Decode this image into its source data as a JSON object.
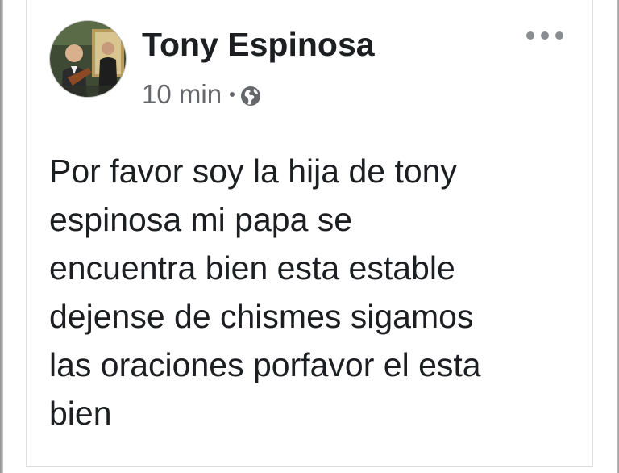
{
  "post": {
    "author": "Tony Espinosa",
    "time": "10 min",
    "audience_icon": "globe-icon",
    "menu_icon": "more-options-icon",
    "text": "Por favor soy la hija de tony\nespinosa mi papa se\nencuentra bien esta estable\ndejense de chismes sigamos\nlas oraciones porfavor el esta\nbien"
  },
  "colors": {
    "text_primary": "#1c1e21",
    "text_secondary": "#65676b",
    "card_border": "#dcdde0"
  }
}
